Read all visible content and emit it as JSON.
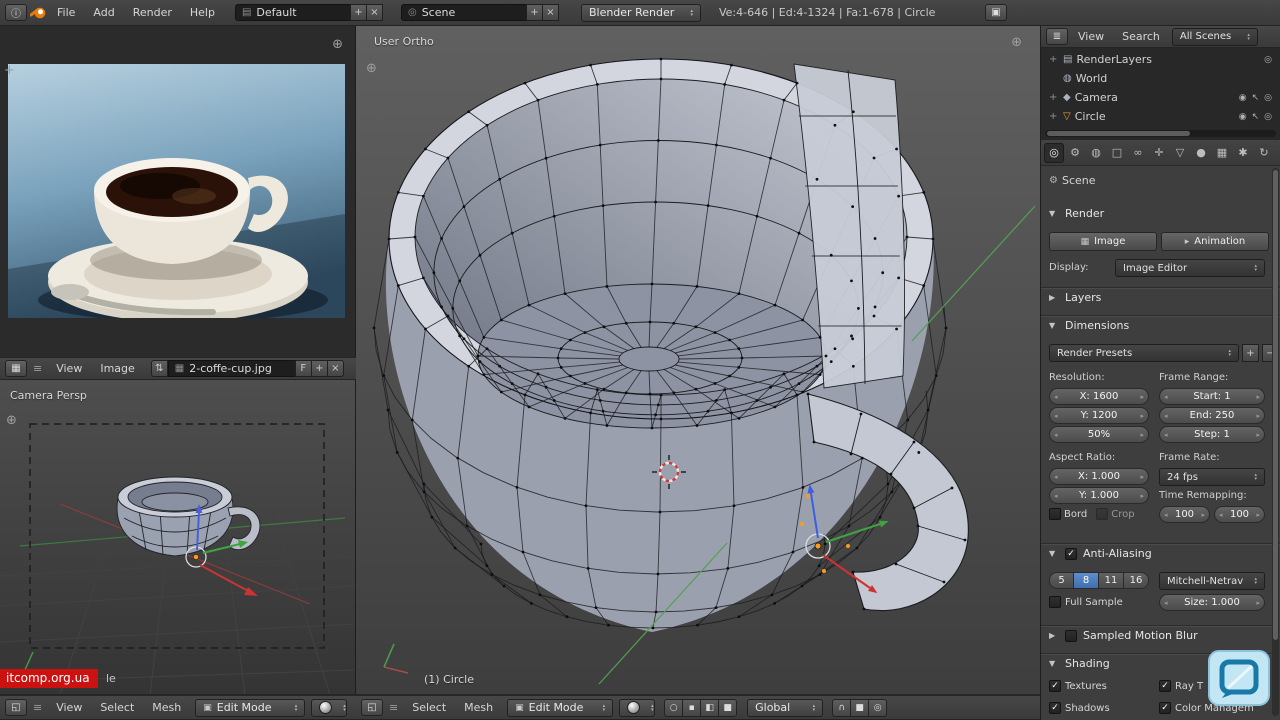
{
  "colors": {
    "accent_blue": "#4a79b8",
    "selection_orange": "#ff9a1a",
    "watermark_bg": "#cc1111",
    "axis_green": "#52a152",
    "axis_red": "#cc3333"
  },
  "icons": {
    "plus": "+",
    "minus": "−",
    "close": "×",
    "corner_plus": "⊕",
    "collapse": "≡",
    "editor_info": "ⓘ",
    "editor_image": "▦",
    "editor_3d": "◱",
    "editor_outliner": "≣",
    "editor_props": "▤",
    "screen": "▤",
    "scene_browse": "◎",
    "browse": "⇅",
    "window": "▣",
    "cube": "▣",
    "proportional": "○",
    "vertex_mode": "▪",
    "edge_mode": "◧",
    "face_mode": "■",
    "snap": "∩",
    "render_preview": "◎",
    "expand": "+",
    "renderlayers": "▤",
    "world": "◍",
    "camera_object": "◆",
    "mesh_data": "▽",
    "eye": "◉",
    "select_arrow": "↖",
    "render_toggle": "◎",
    "image_small": "▦",
    "animation_small": "▸",
    "breadcrumb_scene": "⚙"
  },
  "top_bar": {
    "menus": [
      "File",
      "Add",
      "Render",
      "Help"
    ],
    "layout": "Default",
    "scene": "Scene",
    "engine": "Blender Render",
    "stats": "Ve:4-646 | Ed:4-1324 | Fa:1-678 | Circle"
  },
  "image_editor": {
    "menus": [
      "View",
      "Image"
    ],
    "image_name": "2-coffe-cup.jpg",
    "fake_user_button": "F"
  },
  "camera_view": {
    "label": "Camera Persp"
  },
  "viewport": {
    "label": "User Ortho",
    "status": "(1) Circle"
  },
  "left_footer": {
    "menus": [
      "View",
      "Select",
      "Mesh"
    ],
    "mode": "Edit Mode"
  },
  "center_footer": {
    "menus": [
      "Select",
      "Mesh"
    ],
    "mode": "Edit Mode",
    "orientation": "Global"
  },
  "outliner": {
    "menus": [
      "View",
      "Search"
    ],
    "scope": "All Scenes",
    "items": [
      {
        "label": "RenderLayers"
      },
      {
        "label": "World"
      },
      {
        "label": "Camera"
      },
      {
        "label": "Circle"
      }
    ]
  },
  "properties": {
    "tab_glyphs": [
      "◎",
      "⚙",
      "◍",
      "□",
      "∞",
      "✛",
      "▽",
      "●",
      "▦",
      "✱",
      "↻"
    ],
    "tab_names": [
      "render",
      "scene",
      "world",
      "object",
      "constraints",
      "modifiers",
      "object-data",
      "material",
      "texture",
      "particles",
      "physics"
    ],
    "context": "Scene",
    "render": {
      "title": "Render",
      "image_button": "Image",
      "animation_button": "Animation",
      "display_label": "Display:",
      "display_value": "Image Editor"
    },
    "layers_title": "Layers",
    "dimensions": {
      "title": "Dimensions",
      "presets": "Render Presets",
      "resolution_label": "Resolution:",
      "res_x": "X: 1600",
      "res_y": "Y: 1200",
      "res_pct": "50%",
      "frame_range_label": "Frame Range:",
      "start": "Start: 1",
      "end": "End: 250",
      "step": "Step: 1",
      "aspect_label": "Aspect Ratio:",
      "aspect_x": "X: 1.000",
      "aspect_y": "Y: 1.000",
      "frame_rate_label": "Frame Rate:",
      "fps": "24 fps",
      "remap_label": "Time Remapping:",
      "remap_a": "100",
      "remap_b": "100",
      "border": "Bord",
      "crop": "Crop"
    },
    "antialiasing": {
      "title": "Anti-Aliasing",
      "samples": [
        "5",
        "8",
        "11",
        "16"
      ],
      "selected": "8",
      "filter": "Mitchell-Netrav",
      "full_sample": "Full Sample",
      "size": "Size: 1.000"
    },
    "motion_blur_title": "Sampled Motion Blur",
    "shading": {
      "title": "Shading",
      "textures": "Textures",
      "shadows": "Shadows",
      "ray": "Ray T",
      "color": "Color Managem"
    }
  },
  "watermark": {
    "text": "itcomp.org.ua",
    "fragment": "le"
  }
}
